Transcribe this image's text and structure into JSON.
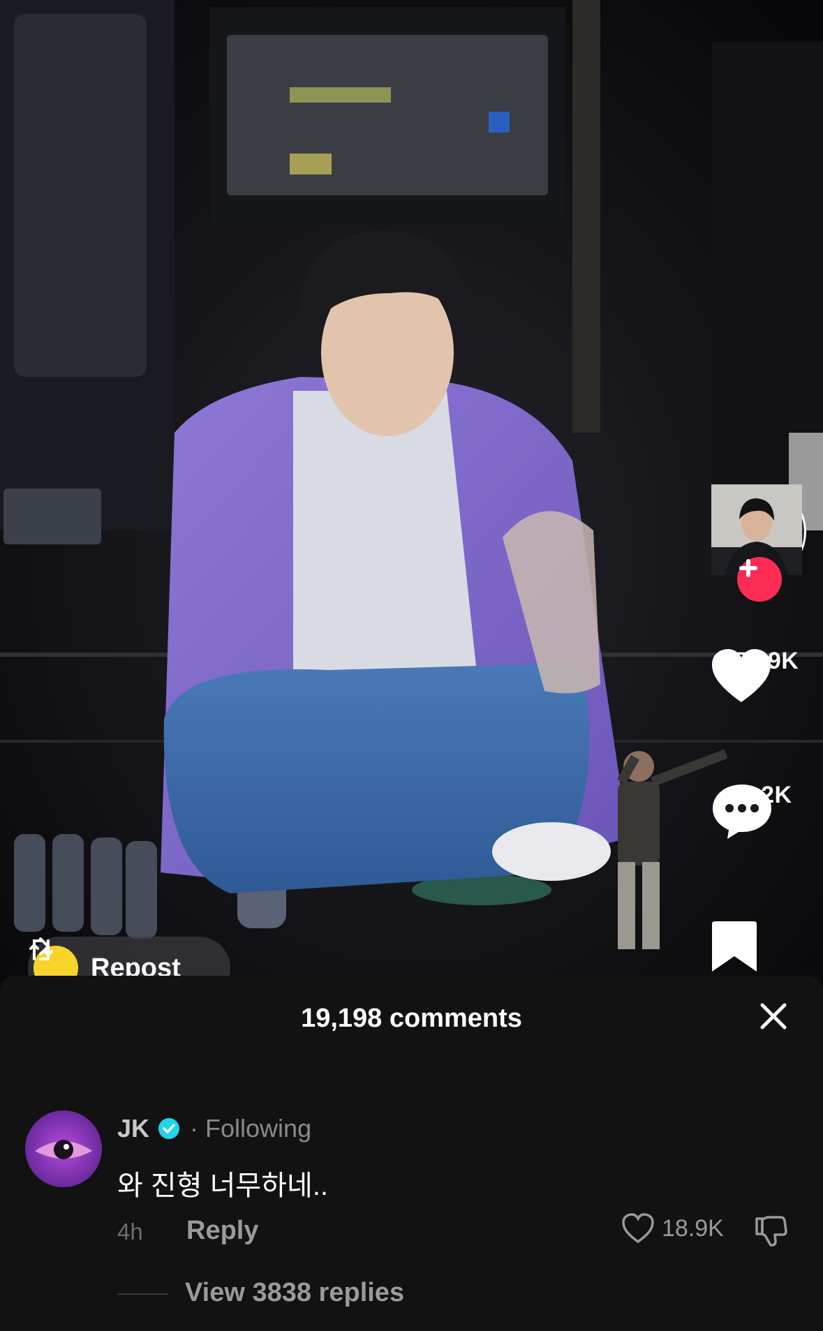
{
  "video": {
    "creator": {
      "avatar_icon": "creator-avatar"
    },
    "actions": {
      "like_count": "857.9K",
      "comment_count": "19.2K"
    },
    "repost": {
      "label": "Repost"
    }
  },
  "comments_sheet": {
    "title": "19,198 comments",
    "comments": [
      {
        "username": "JK",
        "verified": true,
        "relation": "Following",
        "separator": "·",
        "text": "와 진형 너무하네..",
        "time": "4h",
        "reply_label": "Reply",
        "like_count": "18.9K",
        "view_replies": "View 3838 replies"
      }
    ]
  },
  "colors": {
    "accent_red": "#fe2c55",
    "repost_yellow": "#f8d42b",
    "verified_blue": "#20d5ec",
    "sheet_bg": "#121212"
  }
}
